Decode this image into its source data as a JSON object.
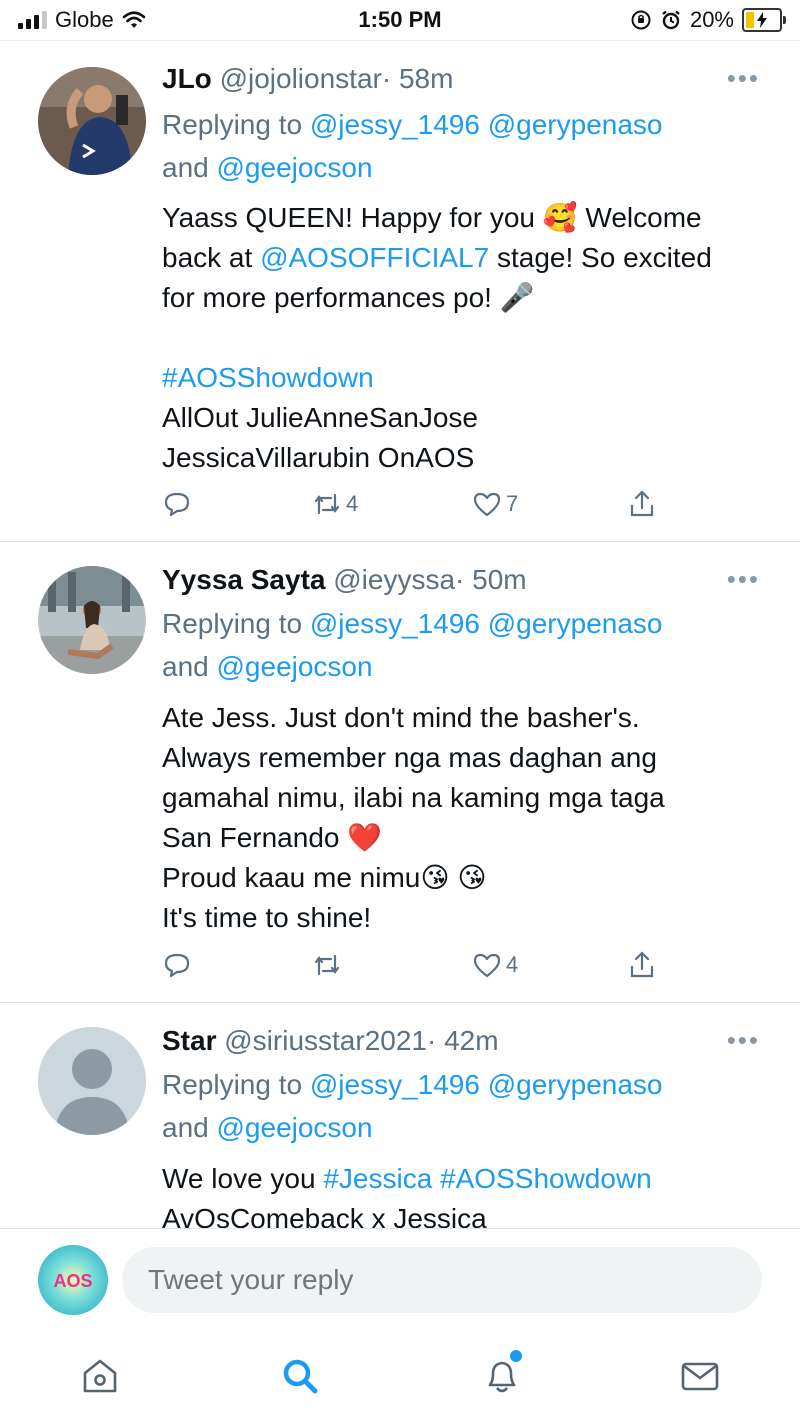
{
  "status_bar": {
    "carrier": "Globe",
    "time": "1:50 PM",
    "battery": "20%"
  },
  "tweets": [
    {
      "name": "JLo",
      "handle": "@jojolionstar",
      "time": "· 58m",
      "replying_prefix": "Replying to",
      "replying_to": [
        "@jessy_1496",
        "@gerypenaso"
      ],
      "replying_and": "and",
      "replying_last": "@geejocson",
      "lines": {
        "l1a": "Yaass QUEEN! Happy for you",
        "emoji1": "🥰",
        "l1b": "Welcome",
        "l2a": "back at",
        "mention": "@AOSOFFICIAL7",
        "l2b": "stage! So excited",
        "l3": "for more performances po!",
        "emoji2": "🎤",
        "hashtag": "#AOSShowdown",
        "l5": "AllOut JulieAnneSanJose",
        "l6": "JessicaVillarubin OnAOS"
      },
      "retweets": "4",
      "likes": "7"
    },
    {
      "name": "Yyssa Sayta",
      "handle": "@ieyyssa",
      "time": "· 50m",
      "replying_prefix": "Replying to",
      "replying_to": [
        "@jessy_1496",
        "@gerypenaso"
      ],
      "replying_and": "and",
      "replying_last": "@geejocson",
      "lines": {
        "l1": "Ate Jess. Just don't mind the basher's.",
        "l2": "Always remember nga mas daghan ang",
        "l3": "gamahal nimu, ilabi na kaming mga taga",
        "l4": "San Fernando",
        "emoji_heart": "❤️",
        "l5": "Proud kaau me nimu",
        "emoji_kiss": "😘 😘",
        "l6": "It's time to shine!"
      },
      "retweets": "",
      "likes": "4"
    },
    {
      "name": "Star",
      "handle": "@siriusstar2021",
      "time": "· 42m",
      "replying_prefix": "Replying to",
      "replying_to": [
        "@jessy_1496",
        "@gerypenaso"
      ],
      "replying_and": "and",
      "replying_last": "@geejocson",
      "lines": {
        "l1a": "We love you",
        "hashtag1": "#Jessica",
        "hashtag2": "#AOSShowdown",
        "l2": "AvOsComeback x Jessica"
      }
    }
  ],
  "reply_bar": {
    "avatar_text": "AOS",
    "placeholder": "Tweet your reply"
  },
  "tab_bar": {
    "tabs": [
      "home-icon",
      "search-icon",
      "notifications-icon",
      "messages-icon"
    ],
    "active": "search-icon"
  },
  "colors": {
    "accent": "#1d9bf0",
    "secondary_text": "#5b7083"
  }
}
